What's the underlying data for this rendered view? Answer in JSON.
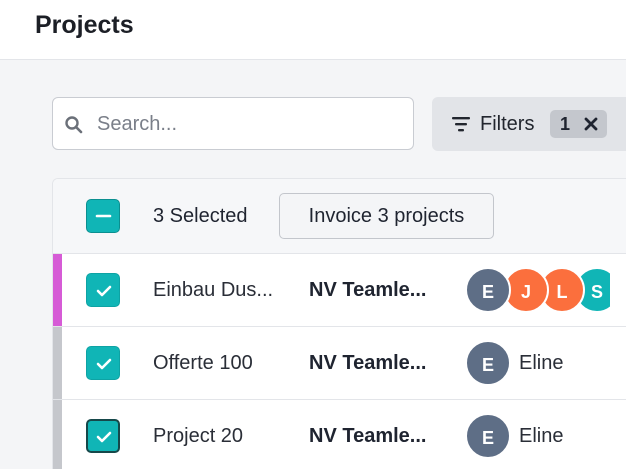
{
  "header": {
    "title": "Projects"
  },
  "search": {
    "placeholder": "Search..."
  },
  "filters": {
    "label": "Filters",
    "count": "1"
  },
  "selection": {
    "count_label": "3 Selected",
    "invoice_label": "Invoice 3 projects"
  },
  "rows": [
    {
      "name": "Einbau Dus...",
      "client": "NV Teamle...",
      "stripe_color": "#d65bd6",
      "checked": true,
      "avatars": [
        {
          "initial": "E",
          "color": "#5e6e86"
        },
        {
          "initial": "J",
          "color": "#fb6f3d"
        },
        {
          "initial": "L",
          "color": "#fb6f3d"
        },
        {
          "initial": "S",
          "color": "#10b5b6"
        }
      ],
      "assignee": ""
    },
    {
      "name": "Offerte 100",
      "client": "NV Teamle...",
      "stripe_color": "#c5c7cc",
      "checked": true,
      "avatars": [
        {
          "initial": "E",
          "color": "#5e6e86"
        }
      ],
      "assignee": "Eline"
    },
    {
      "name": "Project 20",
      "client": "NV Teamle...",
      "stripe_color": "#c5c7cc",
      "checked": true,
      "avatars": [
        {
          "initial": "E",
          "color": "#5e6e86"
        }
      ],
      "assignee": "Eline"
    }
  ],
  "colors": {
    "accent": "#10b5b6",
    "orange": "#fb6f3d",
    "slate": "#5e6e86"
  }
}
